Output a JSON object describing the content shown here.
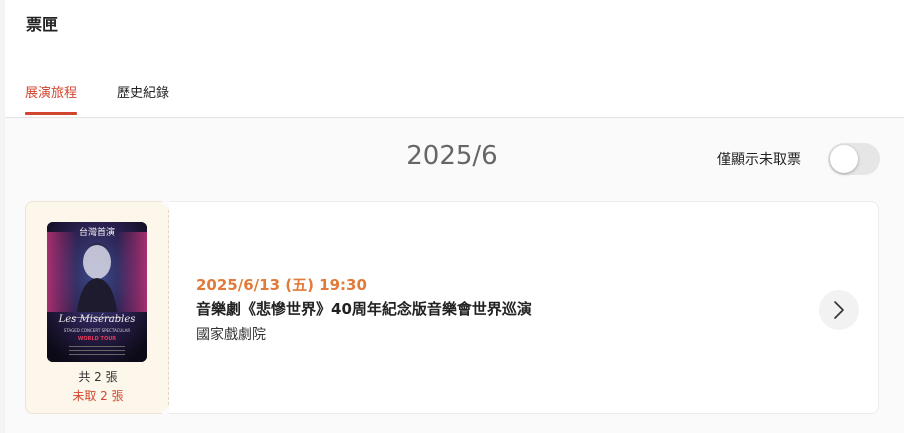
{
  "page": {
    "title": "票匣"
  },
  "tabs": [
    {
      "label": "展演旅程",
      "active": true
    },
    {
      "label": "歷史紀錄",
      "active": false
    }
  ],
  "month_heading": "2025/6",
  "filter": {
    "label": "僅顯示未取票",
    "enabled": false
  },
  "tickets": [
    {
      "poster": {
        "top_text": "台灣首演",
        "title_text": "Les Misérables",
        "subtitle_text": "STAGED CONCERT SPECTACULAR",
        "tour_text": "WORLD TOUR"
      },
      "count_text": "共 2 張",
      "unclaimed_text": "未取 2 張",
      "datetime": "2025/6/13 (五) 19:30",
      "title": "音樂劇《悲慘世界》40周年紀念版音樂會世界巡演",
      "venue": "國家戲劇院"
    }
  ],
  "icons": {
    "chevron": "chevron-right-icon"
  },
  "colors": {
    "accent": "#d1462f",
    "datetime": "#e07b3b",
    "stub_bg": "#fdf6ea"
  }
}
